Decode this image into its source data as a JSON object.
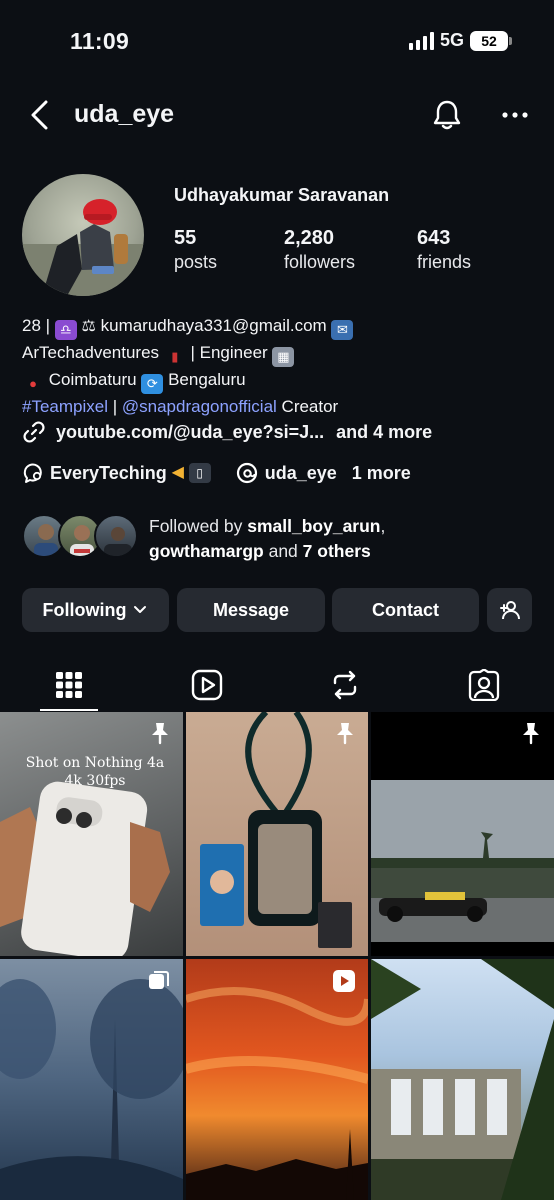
{
  "status_bar": {
    "time": "11:09",
    "network": "5G",
    "battery": "52"
  },
  "header": {
    "username": "uda_eye"
  },
  "profile": {
    "full_name": "Udhayakumar Saravanan",
    "stats": [
      {
        "value": "55",
        "label": "posts"
      },
      {
        "value": "2,280",
        "label": "followers"
      },
      {
        "value": "643",
        "label": "friends"
      }
    ]
  },
  "bio": {
    "line1_a": "28 |",
    "line1_b": "kumarudhaya331@gmail.com",
    "line2_a": "ArTechadventures",
    "line2_b": "| Engineer",
    "line3_a": "Coimbaturu",
    "line3_b": "Bengaluru",
    "line4_tag": "#Teampixel",
    "line4_sep": " | ",
    "line4_mention": "@snapdragonofficial",
    "line4_rest": " Creator"
  },
  "links": {
    "primary": "youtube.com/@uda_eye?si=J...",
    "more": "and 4 more"
  },
  "chips": {
    "community": "EveryTeching",
    "threads": "uda_eye",
    "more": "1 more"
  },
  "followed_by": {
    "prefix": "Followed by ",
    "user1": "small_boy_arun",
    "sep": ",",
    "user2": "gowthamargp",
    "suffix": " and ",
    "others": "7 others"
  },
  "actions": {
    "following": "Following",
    "message": "Message",
    "contact": "Contact"
  },
  "tabs": [
    "grid",
    "reels",
    "reposts",
    "tagged"
  ],
  "posts": [
    {
      "caption": "Shot on Nothing 4a\n4k 30fps",
      "pinned": true
    },
    {
      "caption": "",
      "pinned": true
    },
    {
      "caption": "",
      "pinned": true
    },
    {
      "caption": "",
      "type": "carousel"
    },
    {
      "caption": "",
      "type": "reel"
    },
    {
      "caption": "",
      "type": "photo"
    }
  ],
  "colors": {
    "background": "#0c0f14",
    "button": "#262a31",
    "link": "#8da2ff"
  }
}
